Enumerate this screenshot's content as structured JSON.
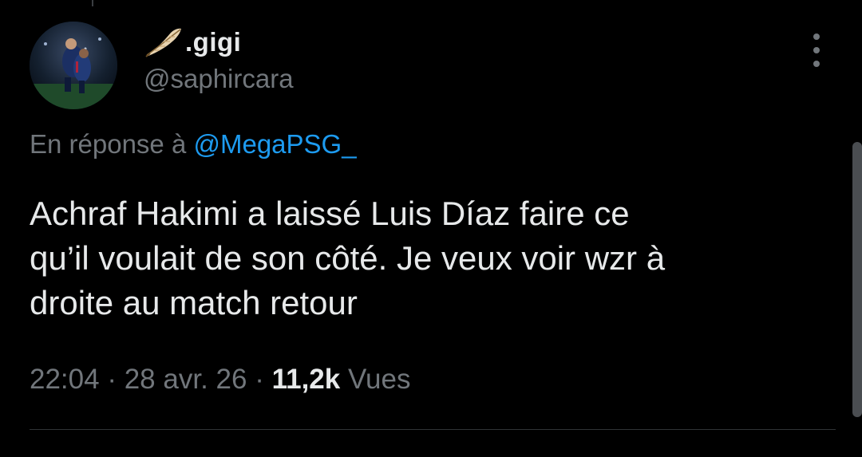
{
  "tweet": {
    "display_name": ".gigi",
    "handle": "@saphircara",
    "reply_prefix": "En réponse à",
    "reply_to": "@MegaPSG_",
    "text_lines": [
      "Achraf Hakimi a laissé Luis Díaz faire ce",
      "qu’il voulait de son côté. Je veux voir wzr à",
      "droite au match retour"
    ],
    "time": "22:04",
    "date": "28 avr. 26",
    "views_count": "11,2k",
    "views_label": "Vues",
    "separator": "·"
  },
  "icons": {
    "name_emoji": "feather-icon",
    "more": "more-vertical-icon"
  },
  "colors": {
    "background": "#000000",
    "primary_text": "#e7e9ea",
    "secondary_text": "#71767b",
    "link": "#1d9bf0",
    "divider": "#2f3336"
  }
}
